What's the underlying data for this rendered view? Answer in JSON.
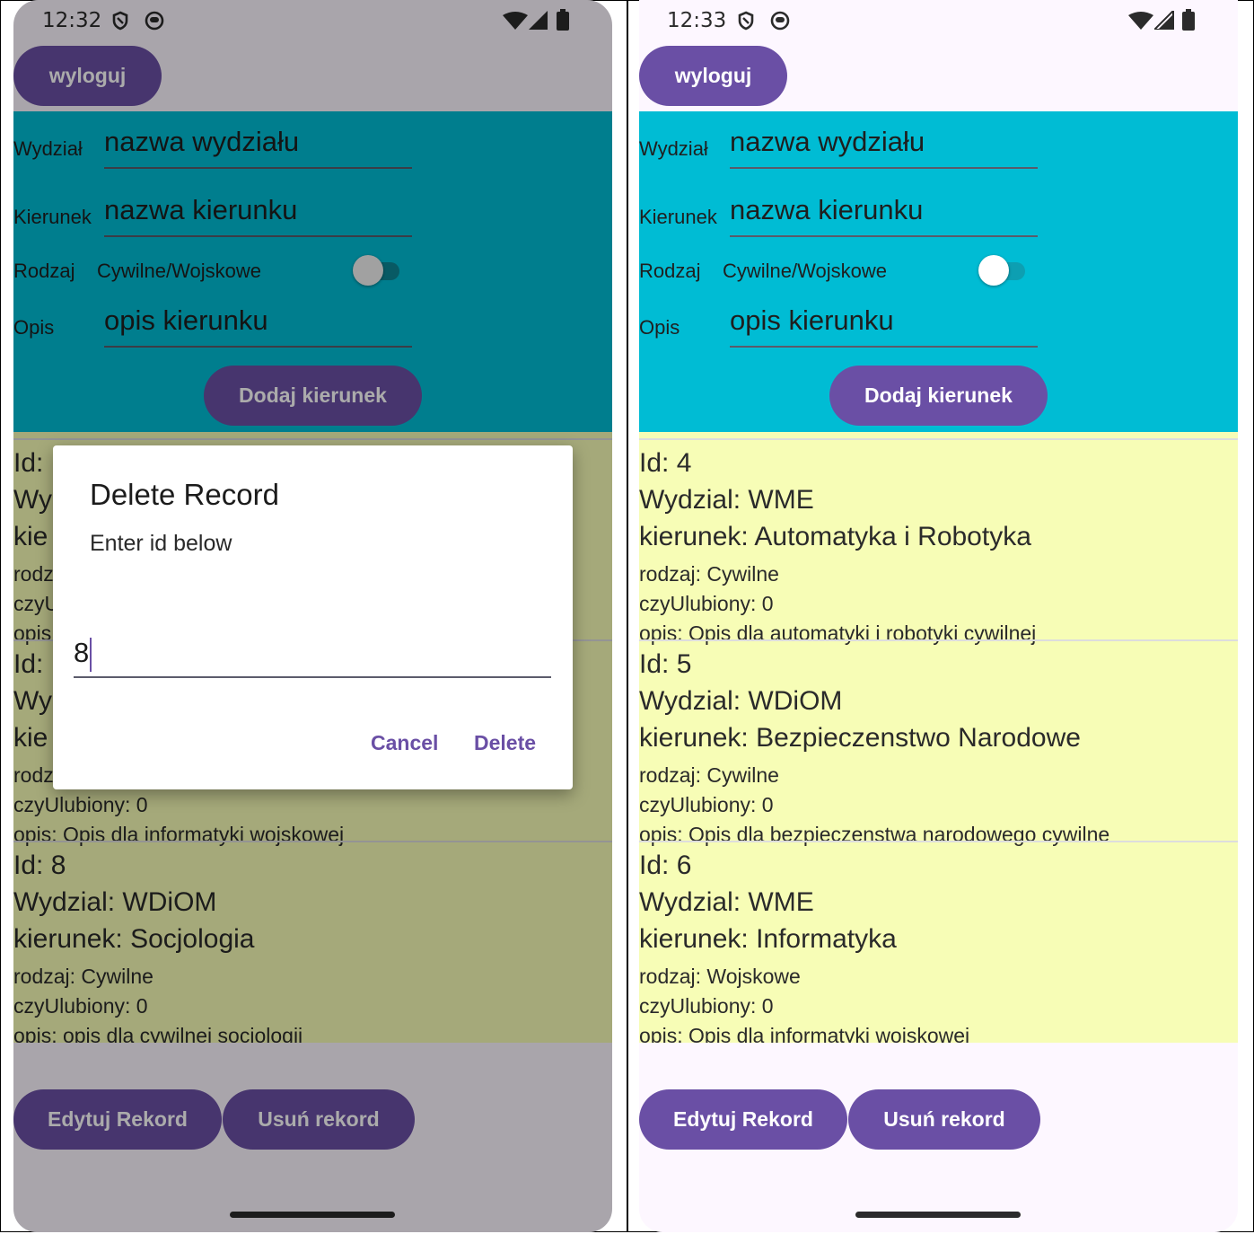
{
  "left_screen": {
    "status": {
      "time": "12:32"
    },
    "logout_label": "wyloguj",
    "form": {
      "faculty_label": "Wydział",
      "faculty_placeholder": "nazwa wydziału",
      "major_label": "Kierunek",
      "major_placeholder": "nazwa kierunku",
      "type_label": "Rodzaj",
      "type_switch_label": "Cywilne/Wojskowe",
      "type_switch_on": false,
      "desc_label": "Opis",
      "desc_placeholder": "opis kierunku",
      "add_button": "Dodaj kierunek"
    },
    "records": [
      {
        "id": "Id: ",
        "faculty": "Wy",
        "major": "kie",
        "type": "rodz",
        "fav": "czyU",
        "desc": "opis"
      },
      {
        "id": "Id: ",
        "faculty": "Wy",
        "major": "kie",
        "type": "rodz",
        "fav": "czyUlubiony: 0",
        "desc": "opis: Opis dla informatyki wojskowej"
      },
      {
        "id": "Id: 8",
        "faculty": "Wydzial: WDiOM",
        "major": "kierunek: Socjologia",
        "type": "rodzaj: Cywilne",
        "fav": "czyUlubiony: 0",
        "desc": "opis: opis dla cywilnej socjologii"
      }
    ],
    "edit_button": "Edytuj Rekord",
    "delete_button": "Usuń rekord",
    "dialog": {
      "title": "Delete Record",
      "message": "Enter id below",
      "input_value": "8",
      "cancel": "Cancel",
      "delete": "Delete"
    }
  },
  "right_screen": {
    "status": {
      "time": "12:33"
    },
    "logout_label": "wyloguj",
    "form": {
      "faculty_label": "Wydział",
      "faculty_placeholder": "nazwa wydziału",
      "major_label": "Kierunek",
      "major_placeholder": "nazwa kierunku",
      "type_label": "Rodzaj",
      "type_switch_label": "Cywilne/Wojskowe",
      "type_switch_on": false,
      "desc_label": "Opis",
      "desc_placeholder": "opis kierunku",
      "add_button": "Dodaj kierunek"
    },
    "records": [
      {
        "id": "Id: 4",
        "faculty": "Wydzial: WME",
        "major": "kierunek: Automatyka i Robotyka",
        "type": "rodzaj: Cywilne",
        "fav": "czyUlubiony: 0",
        "desc": "opis: Opis dla automatyki i robotyki cywilnej"
      },
      {
        "id": "Id: 5",
        "faculty": "Wydzial: WDiOM",
        "major": "kierunek: Bezpieczenstwo Narodowe",
        "type": "rodzaj: Cywilne",
        "fav": "czyUlubiony: 0",
        "desc": "opis: Opis dla bezpieczenstwa narodowego cywilne"
      },
      {
        "id": "Id: 6",
        "faculty": "Wydzial: WME",
        "major": "kierunek: Informatyka",
        "type": "rodzaj: Wojskowe",
        "fav": "czyUlubiony: 0",
        "desc": "opis: Opis dla informatyki wojskowej"
      }
    ],
    "edit_button": "Edytuj Rekord",
    "delete_button": "Usuń rekord"
  },
  "colors": {
    "primary": "#6a4fa5",
    "form_bg": "#00bcd4",
    "list_bg": "#f7fdb6",
    "screen_bg": "#fdf7ff"
  },
  "icons": [
    "shield-icon",
    "robot-face-icon",
    "wifi-icon",
    "signal-icon",
    "battery-icon"
  ]
}
